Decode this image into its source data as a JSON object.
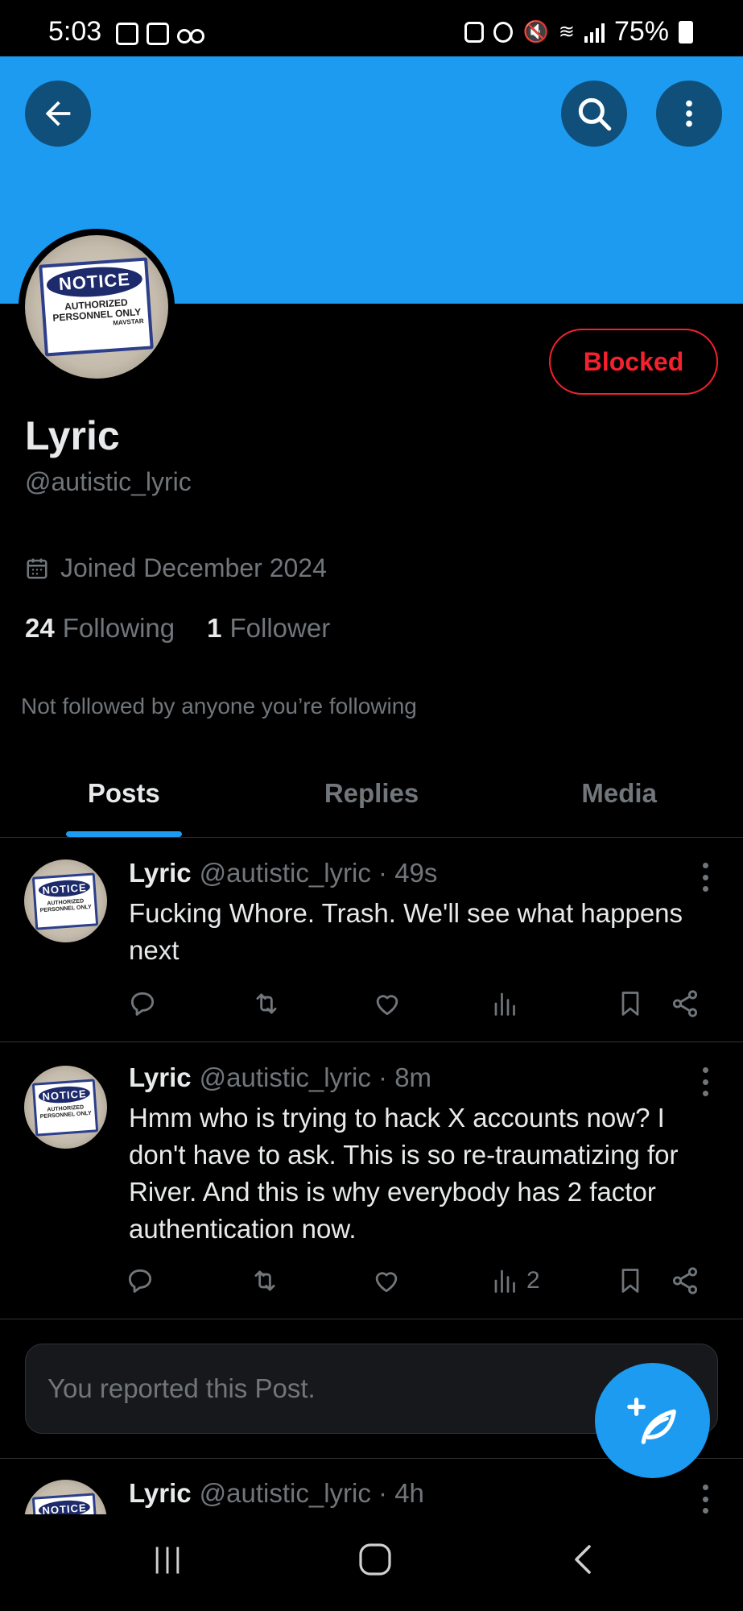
{
  "status_bar": {
    "time": "5:03",
    "battery": "75%"
  },
  "profile": {
    "name": "Lyric",
    "handle": "@autistic_lyric",
    "joined": "Joined December 2024",
    "following_count": "24",
    "following_label": "Following",
    "followers_count": "1",
    "followers_label": "Follower",
    "followed_by": "Not followed by anyone you’re following",
    "blocked_label": "Blocked"
  },
  "avatar_sign": {
    "header": "NOTICE",
    "line1": "AUTHORIZED",
    "line2": "PERSONNEL ONLY",
    "brand": "MAVSTAR"
  },
  "tabs": [
    {
      "label": "Posts",
      "active": true
    },
    {
      "label": "Replies",
      "active": false
    },
    {
      "label": "Media",
      "active": false
    }
  ],
  "posts": [
    {
      "name": "Lyric",
      "meta": "@autistic_lyric · 49s",
      "text": "Fucking Whore. Trash. We'll see what happens next",
      "views": ""
    },
    {
      "name": "Lyric",
      "meta": "@autistic_lyric · 8m",
      "text": "Hmm who is trying to hack X accounts now? I don't have to ask. This is so re-traumatizing for River. And this is why everybody has 2 factor authentication now.",
      "views": "2"
    },
    {
      "name": "Lyric",
      "meta": "@autistic_lyric · 4h",
      "text": "",
      "views": ""
    }
  ],
  "reported_notice": "You reported this Post.",
  "colors": {
    "accent": "#1d9bf0",
    "blocked": "#f4212e",
    "muted": "#71767b"
  }
}
